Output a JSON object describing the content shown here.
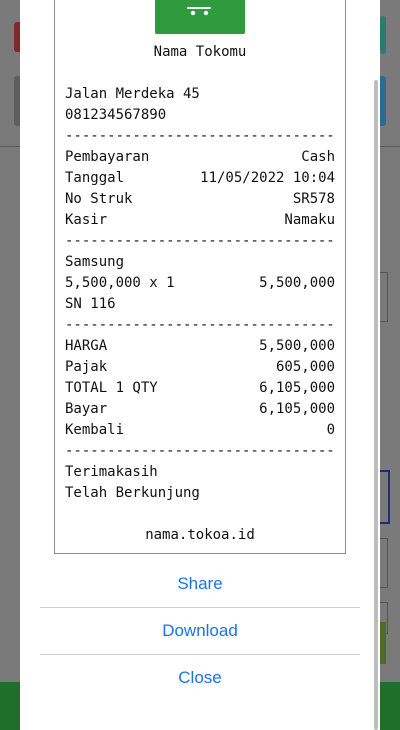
{
  "receipt": {
    "store_name": "Nama Tokomu",
    "address": "Jalan Merdeka 45",
    "phone": "081234567890",
    "separator": "--------------------------------",
    "payment": {
      "label": "Pembayaran",
      "value": "Cash"
    },
    "date": {
      "label": "Tanggal",
      "value": "11/05/2022 10:04"
    },
    "receipt_no": {
      "label": "No Struk",
      "value": "SR578"
    },
    "cashier": {
      "label": "Kasir",
      "value": "Namaku"
    },
    "item": {
      "name": "Samsung",
      "qty_line": "5,500,000 x 1",
      "amount": "5,500,000",
      "serial": "SN 116"
    },
    "price": {
      "label": "HARGA",
      "value": "5,500,000"
    },
    "tax": {
      "label": "Pajak",
      "value": "605,000"
    },
    "total": {
      "label": "TOTAL 1 QTY",
      "value": "6,105,000"
    },
    "paid": {
      "label": "Bayar",
      "value": "6,105,000"
    },
    "change": {
      "label": "Kembali",
      "value": "0"
    },
    "thanks_1": "Terimakasih",
    "thanks_2": "Telah Berkunjung",
    "website": "nama.tokoa.id"
  },
  "actions": {
    "share": "Share",
    "download": "Download",
    "close": "Close"
  },
  "colors": {
    "accent": "#1a73e8",
    "logo_green": "#2e9b3e"
  },
  "icons": {
    "logo": "cart-icon"
  }
}
